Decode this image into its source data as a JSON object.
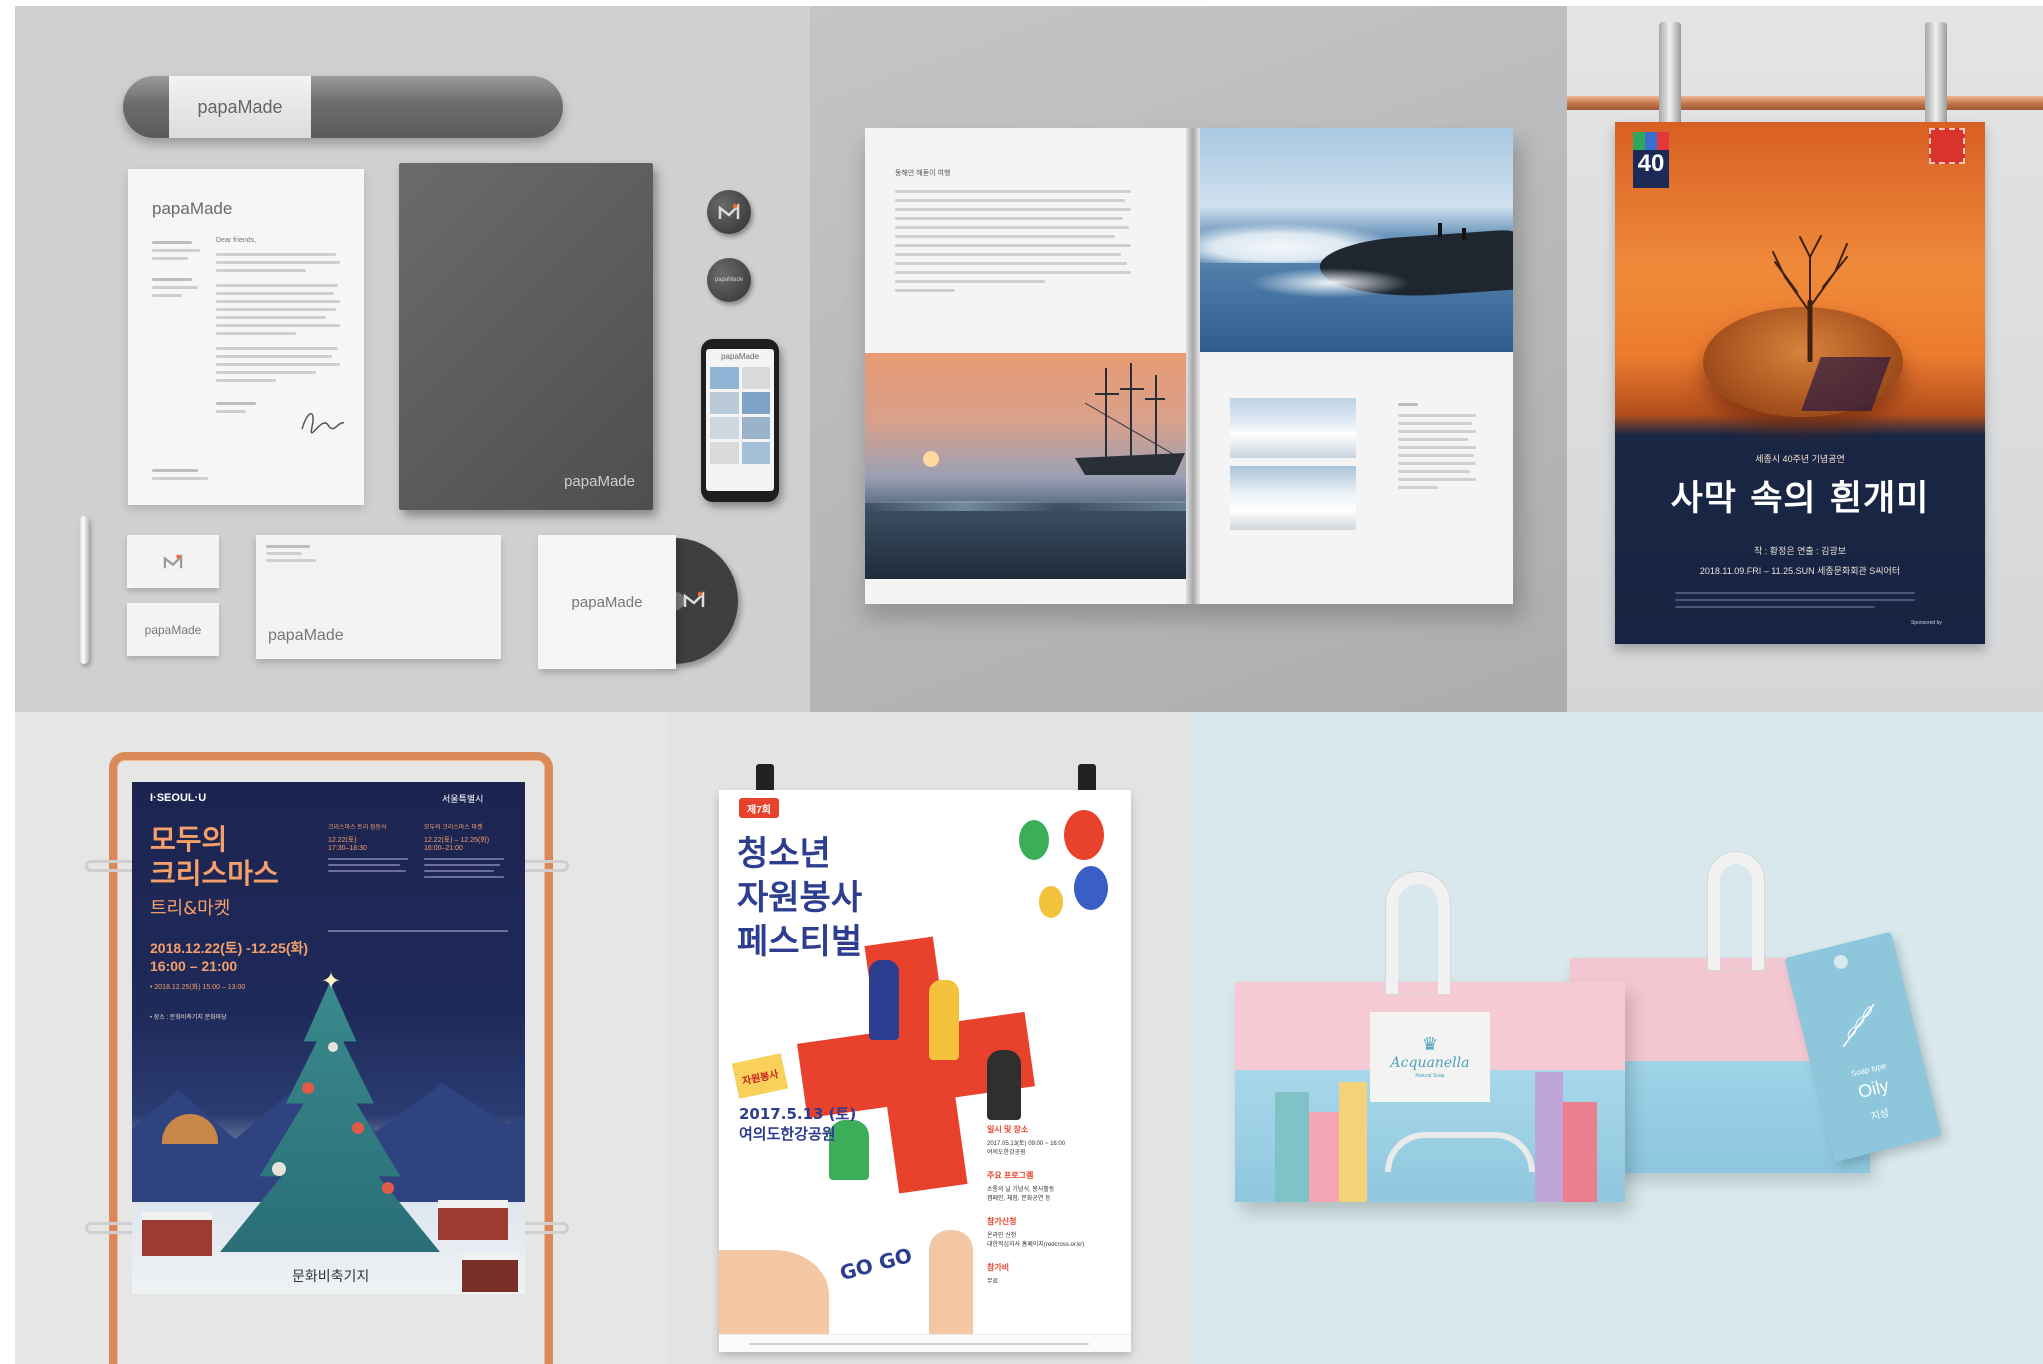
{
  "stationery": {
    "brand": "papaMade",
    "tube_label": "papaMade",
    "letterhead_logo": "papaMade",
    "letter_greeting": "Dear friends,",
    "notebook_logo": "papaMade",
    "phone_logo": "papaMade",
    "card_logo": "papaMade",
    "envelope_logo": "papaMade",
    "cd_sleeve_logo": "papaMade"
  },
  "magazine": {
    "article_title": "동해안 해돋이 여행"
  },
  "desert_poster": {
    "badge_number": "40",
    "pretitle": "세종시 40주년 기념공연",
    "title": "사막 속의 흰개미",
    "credits": "작 : 황정은   연출 : 김광보",
    "dates": "2018.11.09.FRI – 11.25.SUN 세종문화회관 S씨어터",
    "sponsor": "Sponsored by"
  },
  "christmas_poster": {
    "top_logo": "I·SEOUL·U",
    "city_logo": "서울특별시",
    "title_line1": "모두의",
    "title_line2": "크리스마스",
    "subtitle": "트리&마켓",
    "date_range": "2018.12.22(토) -12.25(화)",
    "time_range": "16:00 – 21:00",
    "date_note": "• 2018.12.25(화) 15:00 – 13:00",
    "location": "• 장소 : 문화비축기지 문화마당",
    "program1_title": "크리스마스 트리 점등식",
    "program1_date": "12.22(토)",
    "program1_time": "17:30–18:30",
    "program2_title": "모두의 크리스마스 마켓",
    "program2_date": "12.22(토) – 12.25(화)",
    "program2_time": "16:00–21:00",
    "footer_logo": "문화비축기지"
  },
  "volunteer_poster": {
    "edition_badge": "제7회",
    "title_line1": "청소년",
    "title_line2": "자원봉사",
    "title_line3": "페스티벌",
    "date": "2017.5.13 (토)",
    "venue": "여의도한강공원",
    "section1_title": "일시 및 장소",
    "section1_text": "2017.05.13(토) 09:00 ~ 16:00",
    "section1_text2": "여의도한강공원",
    "section2_title": "주요 프로그램",
    "section2_text": "소통의 날 기념식, 봉사활동",
    "section2_text2": "캠페인, 체험, 문화공연 등",
    "section3_title": "참가신청",
    "section3_text": "온라인 신청",
    "section3_text2": "대한적십자사 홈페이지(redcross.or.kr)",
    "section4_title": "참가비",
    "section4_text": "무료",
    "sign_text": "자원봉사",
    "shout_text": "GO GO"
  },
  "packaging": {
    "brand": "Acquanella",
    "brand_sub": "Natural Soap",
    "tag_type": "Soap type",
    "tag_value": "Oily",
    "tag_korean": "지성"
  },
  "colors": {
    "orange": "#e8692b",
    "navy": "#1d2a55",
    "red": "#e8412c",
    "copper": "#d98a58"
  }
}
